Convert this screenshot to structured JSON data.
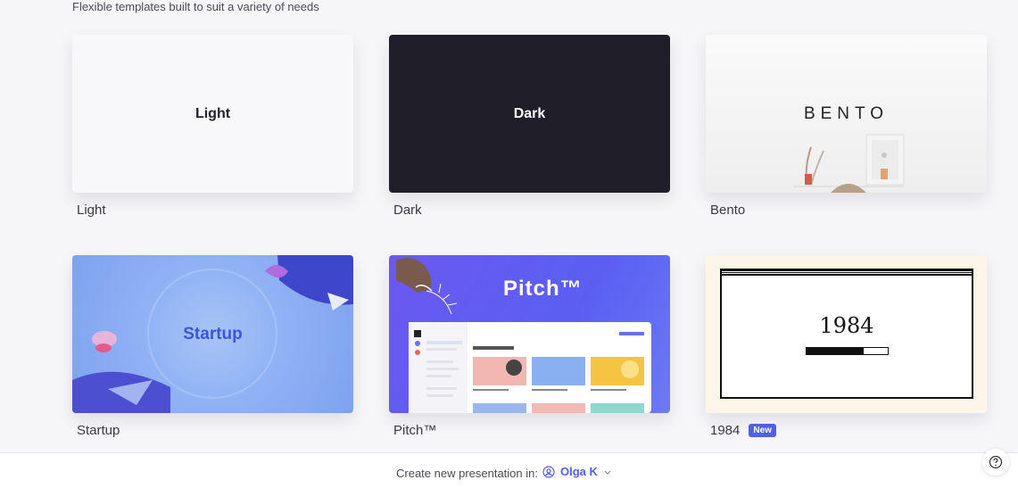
{
  "header": {
    "subtitle": "Flexible templates built to suit a variety of needs"
  },
  "templates": [
    {
      "name": "Light",
      "thumb_text": "Light"
    },
    {
      "name": "Dark",
      "thumb_text": "Dark"
    },
    {
      "name": "Bento",
      "thumb_text": "BENTO"
    },
    {
      "name": "Startup",
      "thumb_text": "Startup"
    },
    {
      "name": "Pitch™",
      "thumb_text": "Pitch™"
    },
    {
      "name": "1984",
      "thumb_text": "1984",
      "badge": "New",
      "progress": 0.7
    }
  ],
  "footer": {
    "create_label": "Create new presentation in:",
    "workspace": "Olga K",
    "workspace_icon": "user-circle-icon",
    "chevron_icon": "chevron-down-icon"
  },
  "help": {
    "icon": "question-circle-icon"
  },
  "colors": {
    "accent": "#4f5fe6",
    "dark_bg": "#201f29",
    "startup_text": "#3b55dc",
    "pitch_bg": "#5a5ff2"
  }
}
